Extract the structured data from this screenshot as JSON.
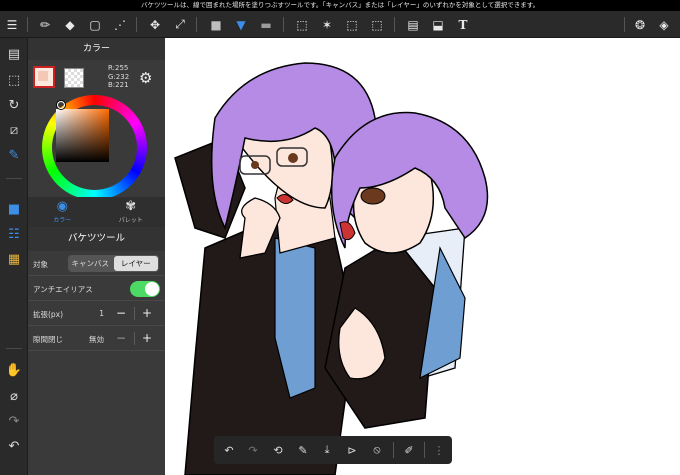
{
  "tip_text": "バケツツールは、線で囲まれた場所を塗りつぶすツールです。「キャンバス」または「レイヤー」のいずれかを対象として選択できます。",
  "toolbar": {
    "left": [
      {
        "name": "menu-icon",
        "glyph": "☰"
      },
      {
        "name": "brush-tool-icon",
        "glyph": "✏"
      },
      {
        "name": "eraser-tool-icon",
        "glyph": "◆"
      },
      {
        "name": "rect-shape-icon",
        "glyph": "▢"
      },
      {
        "name": "snap-tool-icon",
        "glyph": "⋰"
      },
      {
        "name": "move-tool-icon",
        "glyph": "✥"
      },
      {
        "name": "transform-tool-icon",
        "glyph": "⤢"
      },
      {
        "name": "fill-color-swatch-icon",
        "glyph": "■"
      },
      {
        "name": "bucket-tool-icon",
        "glyph": "▼"
      },
      {
        "name": "gradient-tool-icon",
        "glyph": "▬"
      },
      {
        "name": "select-tool-icon",
        "glyph": "⬚"
      },
      {
        "name": "magic-wand-icon",
        "glyph": "✶"
      },
      {
        "name": "select-pen-icon",
        "glyph": "⬚"
      },
      {
        "name": "select-eraser-icon",
        "glyph": "⬚"
      },
      {
        "name": "frame-divider-icon",
        "glyph": "▤"
      },
      {
        "name": "operation-tool-icon",
        "glyph": "⬓"
      },
      {
        "name": "text-tool-icon",
        "glyph": "T"
      }
    ],
    "right": [
      {
        "name": "material-icon",
        "glyph": "❂"
      },
      {
        "name": "layers-icon",
        "glyph": "◈"
      }
    ]
  },
  "leftcol": [
    {
      "name": "pages-icon",
      "glyph": "▤"
    },
    {
      "name": "selection-icon",
      "glyph": "⬚"
    },
    {
      "name": "rotate-icon",
      "glyph": "↻"
    },
    {
      "name": "ruler-icon",
      "glyph": "⧄"
    },
    {
      "name": "pen-color-icon",
      "glyph": "✎"
    },
    {
      "name": "color-panel-icon",
      "glyph": "■"
    },
    {
      "name": "brush-panel-icon",
      "glyph": "☷"
    },
    {
      "name": "layer-panel-icon",
      "glyph": "▦"
    },
    {
      "name": "hand-tool-icon",
      "glyph": "✋"
    },
    {
      "name": "eyedropper-icon",
      "glyph": "⌀"
    },
    {
      "name": "redo-icon",
      "glyph": "↷"
    },
    {
      "name": "undo-icon",
      "glyph": "↶"
    }
  ],
  "panel": {
    "color_title": "カラー",
    "rgb": {
      "r": "R:255",
      "g": "G:232",
      "b": "B:221"
    },
    "tabs": [
      {
        "label": "カラー",
        "glyph": "◉"
      },
      {
        "label": "パレット",
        "glyph": "✾"
      }
    ],
    "tool_title": "バケツツール",
    "target_label": "対象",
    "target_options": [
      "キャンバス",
      "レイヤー"
    ],
    "target_selected": "レイヤー",
    "antialias_label": "アンチエイリアス",
    "antialias_on": true,
    "expand_label": "拡張(px)",
    "expand_value": "1",
    "gap_close_label": "隙間閉じ",
    "gap_close_value": "無効",
    "minus": "−",
    "plus": "+"
  },
  "bottom_bar": [
    {
      "name": "undo-button-icon",
      "glyph": "↶"
    },
    {
      "name": "redo-button-icon",
      "glyph": "↷"
    },
    {
      "name": "rotate-canvas-icon",
      "glyph": "⟲"
    },
    {
      "name": "dropper-button-icon",
      "glyph": "✎"
    },
    {
      "name": "save-download-icon",
      "glyph": "⤓"
    },
    {
      "name": "flip-icon",
      "glyph": "⊳"
    },
    {
      "name": "no-rotate-icon",
      "glyph": "⦸"
    },
    {
      "name": "edit-icon",
      "glyph": "✐"
    },
    {
      "name": "grip-icon",
      "glyph": "⋮"
    }
  ],
  "colors": {
    "accent": "#3d8ee6",
    "toggle_on": "#4cd964",
    "hair": "#b68be6",
    "skin": "#fde6dc",
    "suit_black": "#221a18",
    "suit_blue": "#6f9fd2",
    "shirt": "#e8eef8"
  }
}
